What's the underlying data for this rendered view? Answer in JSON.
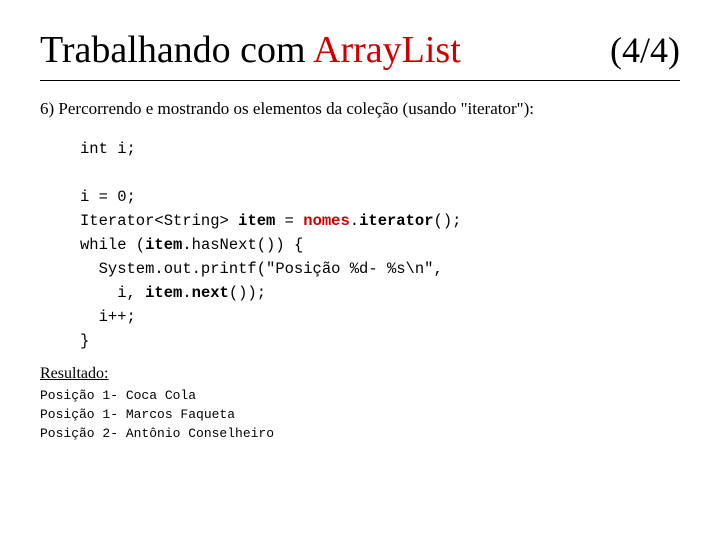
{
  "title": {
    "prefix": "Trabalhando com ",
    "highlight": "ArrayList",
    "suffix": "",
    "number": "(4/4)"
  },
  "subtitle": "6) Percorrendo e mostrando os elementos da coleção (usando \"iterator\"):",
  "code": {
    "lines": [
      {
        "type": "plain",
        "text": "int i;"
      },
      {
        "type": "blank",
        "text": ""
      },
      {
        "type": "plain",
        "text": "i = 0;"
      },
      {
        "type": "mixed",
        "parts": [
          {
            "t": "plain",
            "v": "Iterator<String> "
          },
          {
            "t": "bold",
            "v": "item"
          },
          {
            "t": "plain",
            "v": " = "
          },
          {
            "t": "bold-red",
            "v": "nomes"
          },
          {
            "t": "plain",
            "v": "."
          },
          {
            "t": "bold",
            "v": "iterator"
          },
          {
            "t": "plain",
            "v": "();"
          }
        ]
      },
      {
        "type": "mixed",
        "parts": [
          {
            "t": "plain",
            "v": "while ("
          },
          {
            "t": "bold",
            "v": "item"
          },
          {
            "t": "plain",
            "v": ".hasNext()) {"
          }
        ]
      },
      {
        "type": "mixed",
        "parts": [
          {
            "t": "plain",
            "v": "  System.out.printf(\"Posição %d- %s\\n\","
          }
        ]
      },
      {
        "type": "mixed",
        "parts": [
          {
            "t": "plain",
            "v": "    i, "
          },
          {
            "t": "bold",
            "v": "item"
          },
          {
            "t": "plain",
            "v": "."
          },
          {
            "t": "bold",
            "v": "next"
          },
          {
            "t": "plain",
            "v": "());"
          }
        ]
      },
      {
        "type": "plain",
        "text": "  i++;"
      },
      {
        "type": "plain",
        "text": "}"
      }
    ]
  },
  "resultado": {
    "label": "Resultado:",
    "lines": [
      "Posição 1- Coca Cola",
      "Posição 1- Marcos Faqueta",
      "Posição 2- Antônio Conselheiro"
    ]
  }
}
